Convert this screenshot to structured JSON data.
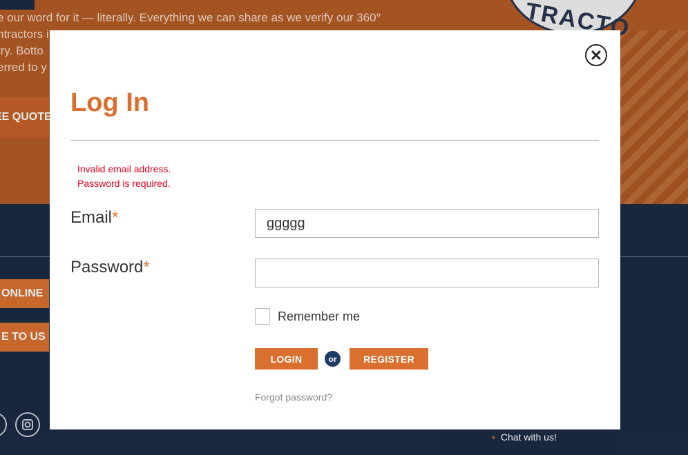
{
  "background": {
    "hero_lines": [
      "e our word for it — literally. Everything we can share as we verify our 360°",
      "ntractors i",
      "try. Botto",
      "erred to y"
    ],
    "badge_text": "TRACTO",
    "quote_button": "EE QUOTE",
    "online_button": "ONLINE",
    "to_us_button": "E TO US",
    "chat_link": "Chat with us!"
  },
  "modal": {
    "title": "Log In",
    "errors": [
      "Invalid email address.",
      "Password is required."
    ],
    "email_label": "Email",
    "password_label": "Password",
    "required_mark": "*",
    "email_value": "ggggg",
    "password_value": "",
    "remember_label": "Remember me",
    "remember_checked": false,
    "login_button": "LOGIN",
    "or_text": "or",
    "register_button": "REGISTER",
    "forgot_link": "Forgot password?"
  },
  "colors": {
    "accent": "#d9702f",
    "navy": "#1b2a44",
    "error": "#e3001b"
  }
}
